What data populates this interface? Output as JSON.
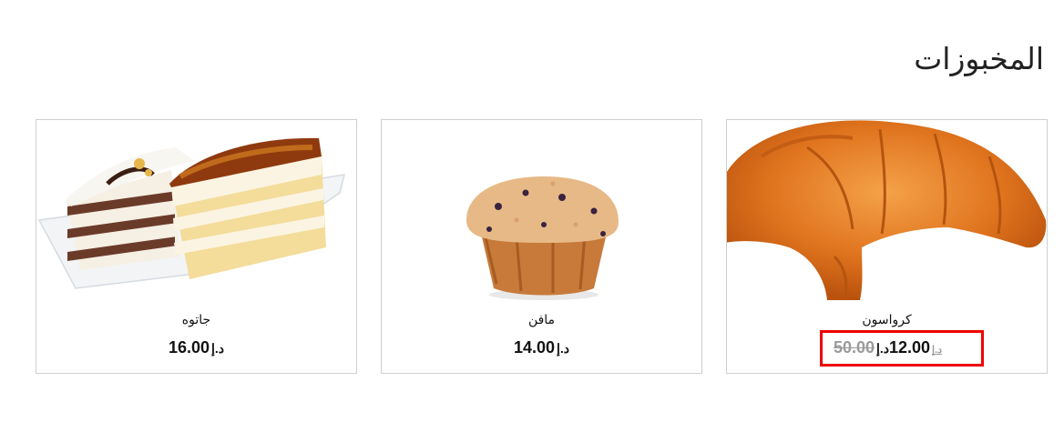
{
  "section": {
    "title": "المخبوزات"
  },
  "products": [
    {
      "name": "كرواسون",
      "price": "12.00",
      "currency": "د.إ",
      "old_price": "50.00",
      "old_currency": "د.إ",
      "image_icon": "croissant-image"
    },
    {
      "name": "مافن",
      "price": "14.00",
      "currency": "د.إ",
      "image_icon": "muffin-image"
    },
    {
      "name": "جاتوه",
      "price": "16.00",
      "currency": "د.إ",
      "image_icon": "cake-slices-image"
    }
  ],
  "colors": {
    "highlight": "#ee0000",
    "strike_price": "#9a9a9a",
    "card_border": "#cfcfcf"
  }
}
